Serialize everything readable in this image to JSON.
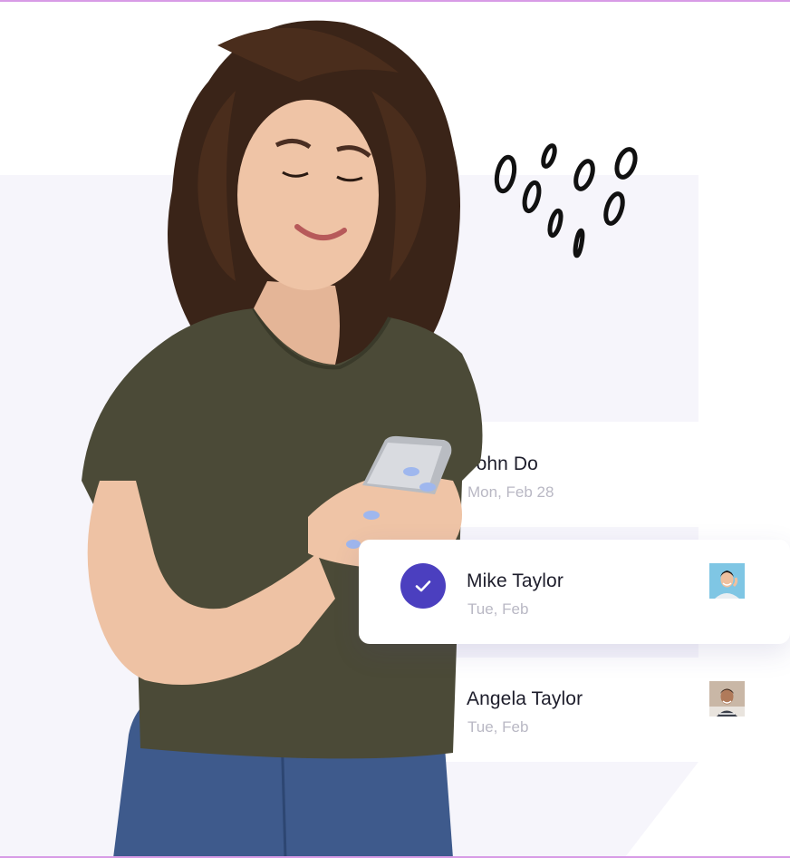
{
  "contacts": [
    {
      "name": "John Do",
      "date": "Mon, Feb 28",
      "selected": false,
      "avatar": "none"
    },
    {
      "name": "Mike Taylor",
      "date": "Tue, Feb",
      "selected": true,
      "avatar": "mike-avatar"
    },
    {
      "name": "Angela Taylor",
      "date": "Tue, Feb",
      "selected": false,
      "avatar": "angela-avatar"
    }
  ],
  "colors": {
    "accent": "#4b3fbf",
    "panel_background": "#f6f5fb",
    "name_text": "#1d1d2b",
    "date_text": "#b9b8c4",
    "frame_border": "#d89be6"
  },
  "icons": {
    "selected_indicator": "check-icon",
    "decoration": "doodle-ovals"
  }
}
